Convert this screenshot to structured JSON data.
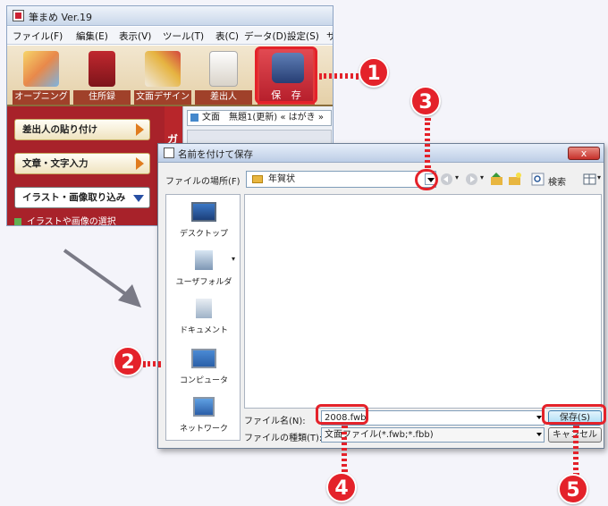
{
  "app": {
    "title": "筆まめ Ver.19",
    "menu": [
      "ファイル(F)",
      "編集(E)",
      "表示(V)",
      "ツール(T)",
      "表(C)",
      "データ(D)",
      "設定(S)",
      "サ"
    ],
    "toolbar": [
      {
        "label": "オープニング",
        "icon": "opening-icon"
      },
      {
        "label": "住所録",
        "icon": "address-book-icon"
      },
      {
        "label": "文面デザイン",
        "icon": "design-icon"
      },
      {
        "label": "差出人",
        "icon": "sender-icon"
      },
      {
        "label": "保 存",
        "icon": "floppy-disk-icon"
      }
    ],
    "side_buttons": [
      "差出人の貼り付け",
      "文章・文字入力",
      "イラスト・画像取り込み"
    ],
    "side_sub_item": "イラストや画像の選択",
    "ribbon_text": "ガ",
    "doc_tab": "文面　無題1(更新) « はがき »"
  },
  "dialog": {
    "title": "名前を付けて保存",
    "close_label": "x",
    "look_in_label": "ファイルの場所(F)",
    "look_in_value": "年賀状",
    "search_label": "検索",
    "places": [
      {
        "label": "デスクトップ",
        "icon": "desktop-icon"
      },
      {
        "label": "ユーザフォルダ",
        "icon": "user-folder-icon"
      },
      {
        "label": "ドキュメント",
        "icon": "documents-icon"
      },
      {
        "label": "コンピュータ",
        "icon": "computer-icon"
      },
      {
        "label": "ネットワーク",
        "icon": "network-icon"
      }
    ],
    "filename_label": "ファイル名(N):",
    "filename_value": "2008.fwb",
    "filetype_label": "ファイルの種類(T):",
    "filetype_value": "文面ファイル(*.fwb;*.fbb)",
    "save_label": "保存(S)",
    "cancel_label": "キャンセル"
  },
  "callouts": [
    "1",
    "2",
    "3",
    "4",
    "5"
  ],
  "colors": {
    "accent": "#e4222a",
    "toolbar_brown": "#a0412a",
    "side_red": "#a8222a"
  }
}
